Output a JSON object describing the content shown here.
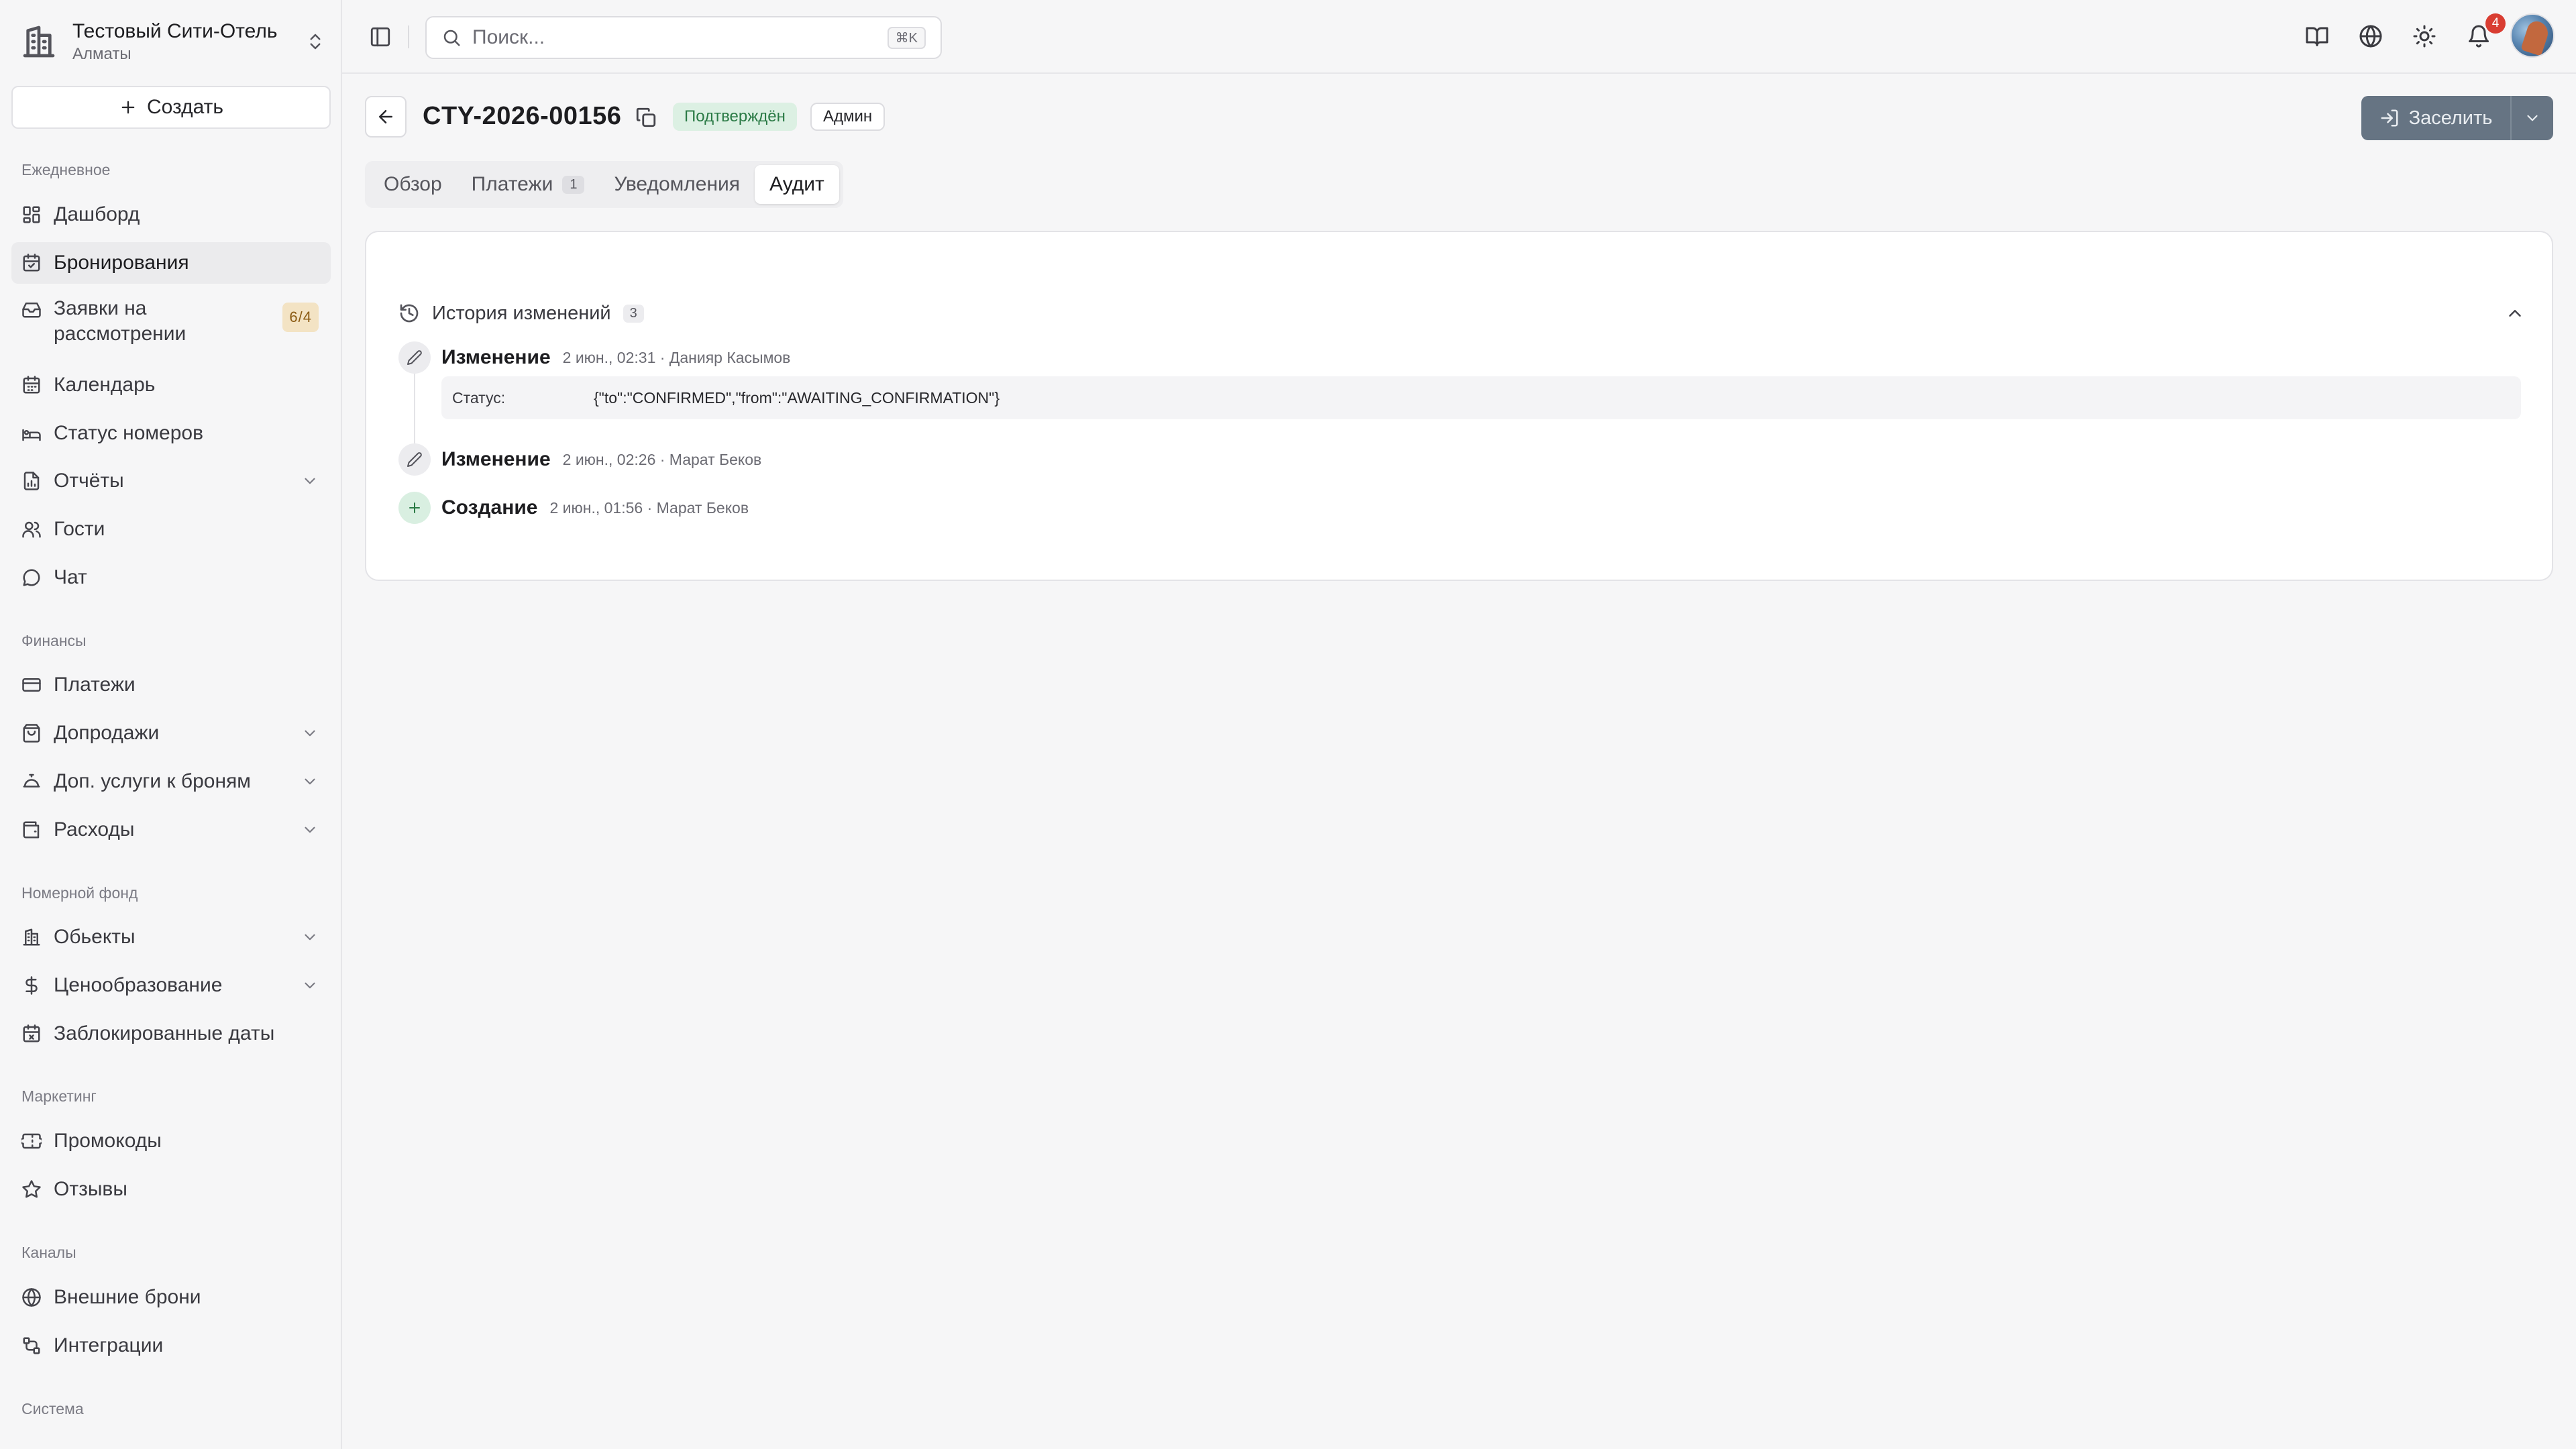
{
  "hotel": {
    "name": "Тестовый Сити-Отель",
    "city": "Алматы"
  },
  "sidebar": {
    "create_label": "Создать",
    "sections": {
      "daily": "Ежедневное",
      "finance": "Финансы",
      "rooms": "Номерной фонд",
      "marketing": "Маркетинг",
      "channels": "Каналы",
      "system": "Система"
    },
    "items": {
      "dashboard": "Дашборд",
      "bookings": "Бронирования",
      "requests": "Заявки на рассмотрении",
      "requests_badge": "6/4",
      "calendar": "Календарь",
      "room_status": "Статус номеров",
      "reports": "Отчёты",
      "guests": "Гости",
      "chat": "Чат",
      "payments": "Платежи",
      "upsells": "Допродажи",
      "extra_services": "Доп. услуги к броням",
      "expenses": "Расходы",
      "properties": "Обьекты",
      "pricing": "Ценообразование",
      "blocked_dates": "Заблокированные даты",
      "promo": "Промокоды",
      "reviews": "Отзывы",
      "external": "Внешние брони",
      "integrations": "Интеграции"
    }
  },
  "topbar": {
    "search_placeholder": "Поиск...",
    "search_shortcut": "⌘K",
    "notification_count": "4"
  },
  "booking": {
    "id": "CTY-2026-00156",
    "status": "Подтверждён",
    "role": "Админ",
    "checkin_label": "Заселить"
  },
  "tabs": [
    {
      "label": "Обзор"
    },
    {
      "label": "Платежи",
      "count": "1"
    },
    {
      "label": "Уведомления"
    },
    {
      "label": "Аудит"
    }
  ],
  "history": {
    "title": "История изменений",
    "count": "3",
    "entries": [
      {
        "type": "Изменение",
        "meta": "2 июн., 02:31 · Данияр Касымов",
        "field": "Статус:",
        "value": "{\"to\":\"CONFIRMED\",\"from\":\"AWAITING_CONFIRMATION\"}"
      },
      {
        "type": "Изменение",
        "meta": "2 июн., 02:26 · Марат Беков"
      },
      {
        "type": "Создание",
        "meta": "2 июн., 01:56 · Марат Беков"
      }
    ]
  },
  "colors": {
    "status_bg": "#dcf0e3",
    "status_text": "#2a7a45",
    "primary_button": "#667483",
    "notification": "#d93d32"
  }
}
